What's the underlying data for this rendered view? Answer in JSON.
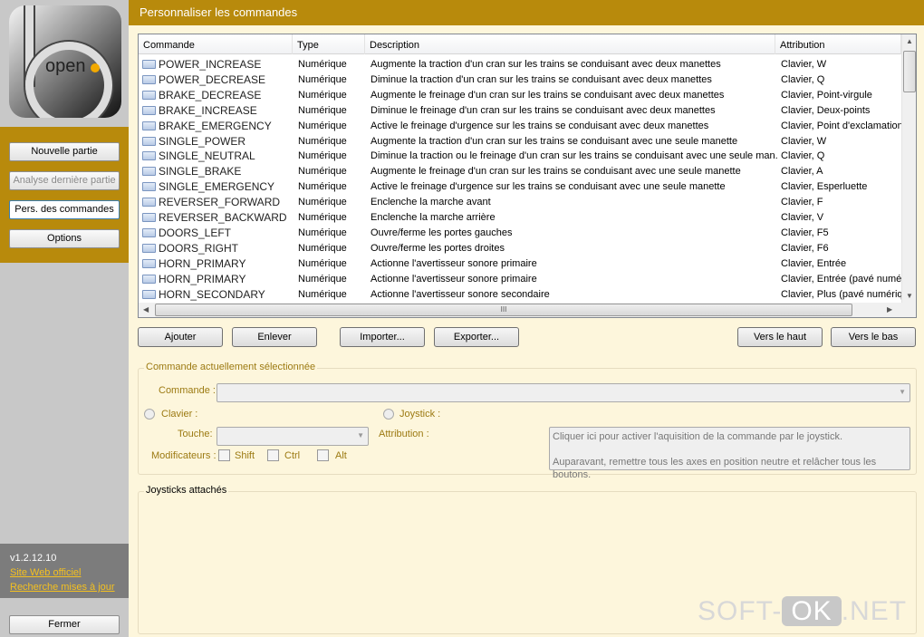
{
  "sidebar": {
    "logo_text": "open",
    "buttons": [
      "Nouvelle partie",
      "Analyse dernière partie",
      "Pers. des commandes",
      "Options"
    ],
    "version": "v1.2.12.10",
    "links": [
      "Site Web officiel",
      "Recherche mises à jour"
    ],
    "close": "Fermer"
  },
  "header": {
    "title": "Personnaliser les commandes"
  },
  "list": {
    "columns": [
      "Commande",
      "Type",
      "Description",
      "Attribution"
    ],
    "rows": [
      [
        "POWER_INCREASE",
        "Numérique",
        "Augmente la traction d'un cran sur les trains se conduisant avec deux manettes",
        "Clavier, W"
      ],
      [
        "POWER_DECREASE",
        "Numérique",
        "Diminue la traction d'un cran sur les trains se conduisant avec deux manettes",
        "Clavier, Q"
      ],
      [
        "BRAKE_DECREASE",
        "Numérique",
        "Augmente le freinage d'un cran sur les trains se conduisant avec deux manettes",
        "Clavier, Point-virgule"
      ],
      [
        "BRAKE_INCREASE",
        "Numérique",
        "Diminue le freinage d'un cran sur les trains se conduisant avec deux manettes",
        "Clavier, Deux-points"
      ],
      [
        "BRAKE_EMERGENCY",
        "Numérique",
        "Active le freinage d'urgence sur les trains se conduisant avec deux manettes",
        "Clavier, Point d'exclamation"
      ],
      [
        "SINGLE_POWER",
        "Numérique",
        "Augmente la traction d'un cran sur les trains se conduisant avec une seule manette",
        "Clavier, W"
      ],
      [
        "SINGLE_NEUTRAL",
        "Numérique",
        "Diminue la traction ou le freinage d'un cran sur les trains se conduisant avec une seule man...",
        "Clavier, Q"
      ],
      [
        "SINGLE_BRAKE",
        "Numérique",
        "Augmente le freinage d'un cran sur les trains se conduisant avec une seule manette",
        "Clavier, A"
      ],
      [
        "SINGLE_EMERGENCY",
        "Numérique",
        "Active le freinage d'urgence sur les trains se conduisant avec une seule manette",
        "Clavier, Esperluette"
      ],
      [
        "REVERSER_FORWARD",
        "Numérique",
        "Enclenche la marche avant",
        "Clavier, F"
      ],
      [
        "REVERSER_BACKWARD",
        "Numérique",
        "Enclenche la marche arrière",
        "Clavier, V"
      ],
      [
        "DOORS_LEFT",
        "Numérique",
        "Ouvre/ferme les portes gauches",
        "Clavier, F5"
      ],
      [
        "DOORS_RIGHT",
        "Numérique",
        "Ouvre/ferme les portes droites",
        "Clavier, F6"
      ],
      [
        "HORN_PRIMARY",
        "Numérique",
        "Actionne l'avertisseur sonore primaire",
        "Clavier, Entrée"
      ],
      [
        "HORN_PRIMARY",
        "Numérique",
        "Actionne l'avertisseur sonore primaire",
        "Clavier, Entrée (pavé numérique)"
      ],
      [
        "HORN_SECONDARY",
        "Numérique",
        "Actionne l'avertisseur sonore secondaire",
        "Clavier, Plus (pavé numérique)"
      ]
    ]
  },
  "actions": {
    "add": "Ajouter",
    "remove": "Enlever",
    "import": "Importer...",
    "export": "Exporter...",
    "up": "Vers le haut",
    "down": "Vers le bas"
  },
  "selected": {
    "title": "Commande actuellement sélectionnée",
    "command_label": "Commande :",
    "command_value": "",
    "keyboard": "Clavier :",
    "joystick": "Joystick :",
    "key_label": "Touche:",
    "key_value": "",
    "modifiers": "Modificateurs :",
    "shift": "Shift",
    "ctrl": "Ctrl",
    "alt": "Alt",
    "assignment": "Attribution :",
    "joystick_hint1": "Cliquer ici pour activer l'aquisition de la commande par le joystick.",
    "joystick_hint2": "Auparavant, remettre tous les axes en position neutre et relâcher tous les boutons."
  },
  "joysticks": {
    "title": "Joysticks attachés"
  },
  "watermark": {
    "left": "SOFT-",
    "mid": "OK",
    ".right": "",
    "right": ".NET"
  },
  "colors": {
    "accent": "#b88a0c",
    "background": "#fdf6dc",
    "link": "#f4c020"
  }
}
